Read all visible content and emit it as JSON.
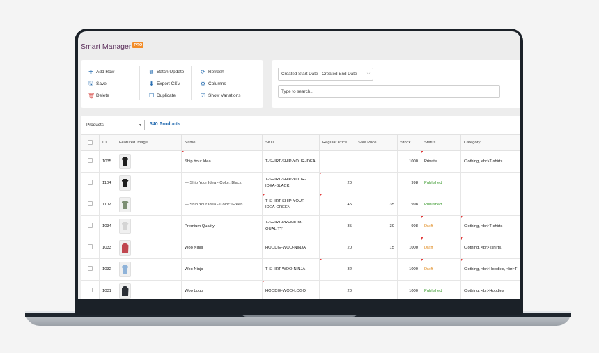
{
  "app": {
    "title": "Smart Manager",
    "badge": "PRO"
  },
  "toolbar": {
    "add_row": "Add Row",
    "save": "Save",
    "delete": "Delete",
    "batch_update": "Batch Update",
    "export_csv": "Export CSV",
    "duplicate": "Duplicate",
    "refresh": "Refresh",
    "columns": "Columns",
    "show_variations": "Show Variations"
  },
  "filters": {
    "date_range": "Created Start Date  - Created End Date",
    "search_placeholder": "Type to search..."
  },
  "grid": {
    "type_select": "Products",
    "count": "340 Products",
    "headers": [
      "ID",
      "Featured Image",
      "Name",
      "SKU",
      "Regular Price",
      "Sale Price",
      "Stock",
      "Status",
      "Category"
    ],
    "rows": [
      {
        "id": "1035",
        "name": "Ship Your Idea",
        "sku": "T-SHIRT-SHIP-YOUR-IDEA",
        "regular": "",
        "sale": "",
        "stock": "1000",
        "status": "Private",
        "category": "Clothing, <br>T-shirts"
      },
      {
        "id": "1104",
        "name": "— Ship Your Idea - Color: Black",
        "sku": "T-SHIRT-SHIP-YOUR-IDEA-BLACK",
        "regular": "20",
        "sale": "",
        "stock": "998",
        "status": "Published",
        "category": ""
      },
      {
        "id": "1102",
        "name": "— Ship Your Idea - Color: Green",
        "sku": "T-SHIRT-SHIP-YOUR-IDEA-GREEN",
        "regular": "45",
        "sale": "35",
        "stock": "998",
        "status": "Published",
        "category": ""
      },
      {
        "id": "1034",
        "name": "Premium Quality",
        "sku": "T-SHIRT-PREMIUM-QUALITY",
        "regular": "35",
        "sale": "30",
        "stock": "998",
        "status": "Draft",
        "category": "Clothing, <br>T-shirts"
      },
      {
        "id": "1033",
        "name": "Woo Ninja",
        "sku": "HOODIE-WOO-NINJA",
        "regular": "20",
        "sale": "15",
        "stock": "1000",
        "status": "Draft",
        "category": "Clothing, <br>Tshirts,"
      },
      {
        "id": "1032",
        "name": "Woo Ninja",
        "sku": "T-SHIRT-WOO-NINJA",
        "regular": "32",
        "sale": "",
        "stock": "1000",
        "status": "Draft",
        "category": "Clothing, <br>Hoodies, <br>T-"
      },
      {
        "id": "1031",
        "name": "Woo Logo",
        "sku": "HOODIE-WOO-LOGO",
        "regular": "20",
        "sale": "",
        "stock": "1000",
        "status": "Published",
        "category": "Clothing, <br>Hoodies"
      }
    ]
  },
  "colors": {
    "accent": "#2a6fb2",
    "title": "#5a2d5a",
    "published": "#3c9a2f",
    "draft": "#e08a1e",
    "badge": "#f28c28"
  }
}
